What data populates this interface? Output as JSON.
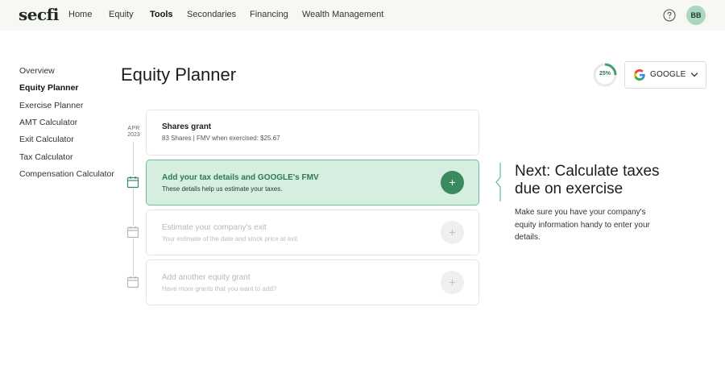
{
  "brand": {
    "logo": "secfi"
  },
  "nav": {
    "items": [
      {
        "label": "Home",
        "active": false
      },
      {
        "label": "Equity",
        "active": false
      },
      {
        "label": "Tools",
        "active": true
      },
      {
        "label": "Secondaries",
        "active": false
      },
      {
        "label": "Financing",
        "active": false
      },
      {
        "label": "Wealth Management",
        "active": false
      }
    ],
    "user_initials": "BB"
  },
  "sidebar": {
    "items": [
      {
        "label": "Overview",
        "active": false
      },
      {
        "label": "Equity Planner",
        "active": true
      },
      {
        "label": "Exercise Planner",
        "active": false
      },
      {
        "label": "AMT Calculator",
        "active": false
      },
      {
        "label": "Exit Calculator",
        "active": false
      },
      {
        "label": "Tax Calculator",
        "active": false
      },
      {
        "label": "Compensation Calculator",
        "active": false
      }
    ]
  },
  "page": {
    "title": "Equity Planner"
  },
  "progress": {
    "label": "25%",
    "value": 0.25
  },
  "company": {
    "name": "GOOGLE"
  },
  "timeline": {
    "date_month": "APR",
    "date_year": "2023",
    "cards": [
      {
        "title": "Shares grant",
        "subtitle": "83 Shares  |  FMV when exercised: $25.67",
        "state": "done"
      },
      {
        "title": "Add your tax details and GOOGLE's FMV",
        "subtitle": "These details help us estimate your taxes.",
        "state": "active"
      },
      {
        "title": "Estimate your company's exit",
        "subtitle": "Your estimate of the date and stock price at exit",
        "state": "muted"
      },
      {
        "title": "Add another equity grant",
        "subtitle": "Have more grants that you want to add?",
        "state": "muted"
      }
    ]
  },
  "next_step": {
    "title": "Next: Calculate taxes due on exercise",
    "description": "Make sure you have your company's equity information handy to enter your details."
  },
  "colors": {
    "accent": "#3a8a60",
    "accent_light": "#d6eedf",
    "nav_bg": "#f7f7f3"
  }
}
